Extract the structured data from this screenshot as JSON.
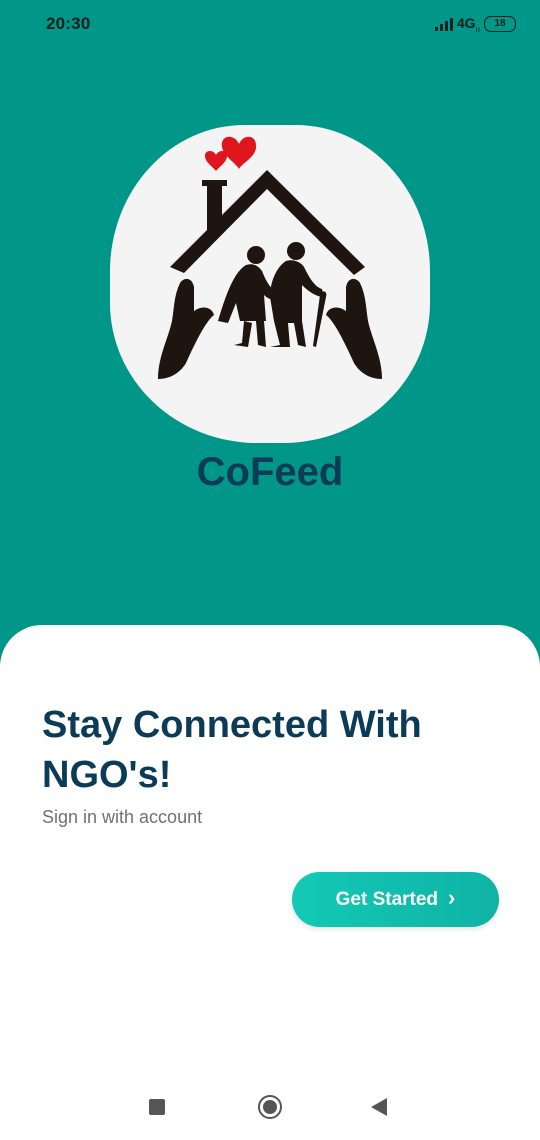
{
  "status_bar": {
    "time": "20:30",
    "network": "4G",
    "network_sub": "ıı",
    "battery": "18"
  },
  "app": {
    "name": "CoFeed",
    "logo_icon": "elderly-care-house-hands-hearts-icon"
  },
  "welcome": {
    "headline": "Stay Connected With NGO's!",
    "subtitle": "Sign in with account",
    "cta_label": "Get Started",
    "cta_icon": "chevron-right-icon"
  },
  "navigation_bar": {
    "recent_icon": "square-recents-icon",
    "home_icon": "circle-home-icon",
    "back_icon": "triangle-back-icon"
  },
  "colors": {
    "primary": "#009688",
    "title": "#0b3b57",
    "cta": "#13c9b6",
    "heart": "#e0161e"
  }
}
